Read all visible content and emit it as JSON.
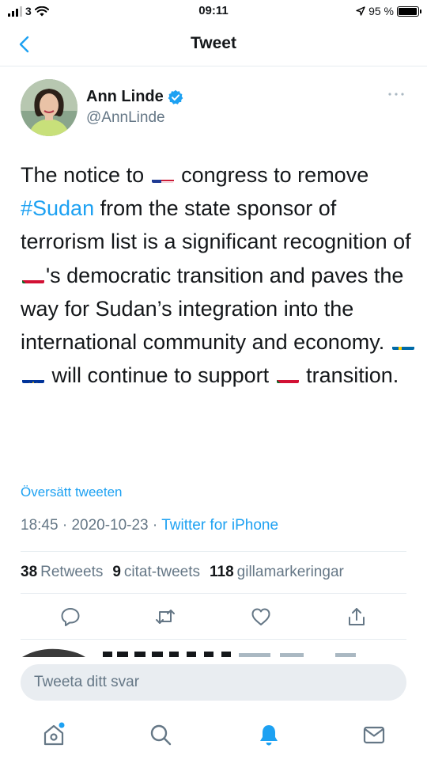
{
  "status_bar": {
    "carrier": "3",
    "time": "09:11",
    "battery_percent": "95 %",
    "battery_level": 0.95
  },
  "nav": {
    "title": "Tweet",
    "back_icon": "chevron-left-icon"
  },
  "tweet": {
    "author_name": "Ann Linde",
    "author_handle": "@AnnLinde",
    "verified": true,
    "text_segments": {
      "s1": "The notice to ",
      "s2": " congress to remove ",
      "hashtag": "#Sudan",
      "s3": " from the state sponsor of terrorism list is a significant recognition of ",
      "s4": "'s democratic transition and paves the way for Sudan’s integration into the international community and economy. ",
      "s5": " will continue to support ",
      "s6": " transition."
    },
    "flags": [
      "us-flag",
      "sudan-flag",
      "sweden-flag",
      "eu-flag",
      "sudan-flag"
    ],
    "translate_label": "Översätt tweeten",
    "time": "18:45",
    "date": "2020-10-23",
    "separator": " · ",
    "source": "Twitter for iPhone"
  },
  "stats": {
    "retweets_count": "38",
    "retweets_label": "Retweets",
    "quotes_count": "9",
    "quotes_label": "citat-tweets",
    "likes_count": "118",
    "likes_label": "gillamarkeringar"
  },
  "actions": [
    "reply-icon",
    "retweet-icon",
    "like-icon",
    "share-icon"
  ],
  "reply": {
    "placeholder": "Tweeta ditt svar"
  },
  "tabbar": {
    "items": [
      "home-icon",
      "search-icon",
      "notifications-icon",
      "messages-icon"
    ],
    "active": "notifications-icon"
  },
  "colors": {
    "accent": "#1da1f2",
    "secondary_text": "#657786",
    "divider": "#e6ecf0",
    "reply_bg": "#e9edf1"
  }
}
